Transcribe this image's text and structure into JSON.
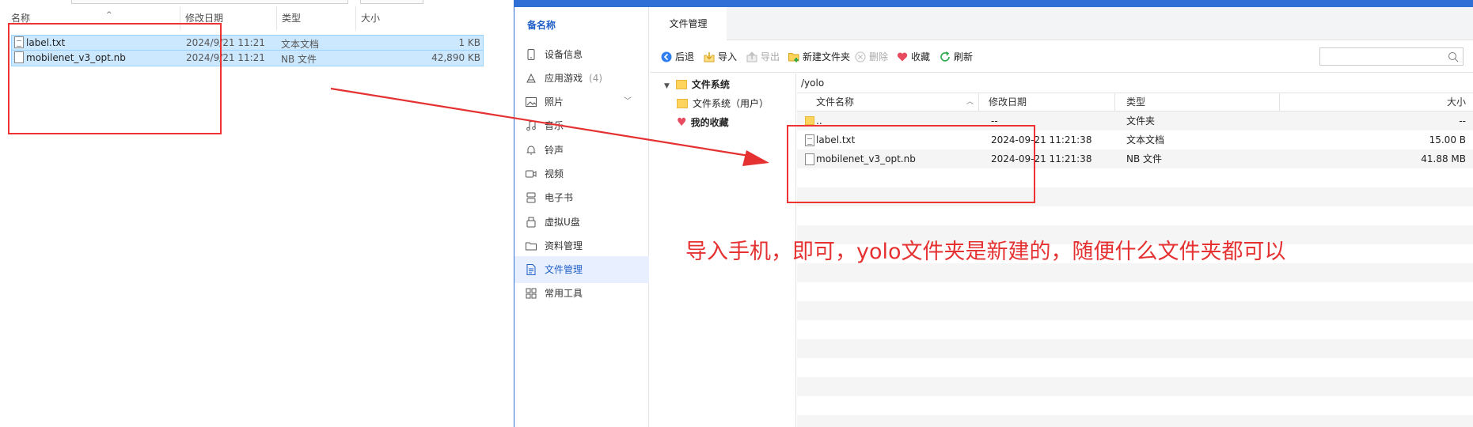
{
  "explorer": {
    "columns": {
      "name": "名称",
      "modified": "修改日期",
      "type": "类型",
      "size": "大小"
    },
    "files": [
      {
        "name": "label.txt",
        "modified": "2024/9/21 11:21",
        "type": "文本文档",
        "size": "1 KB",
        "icon": "text-file-icon"
      },
      {
        "name": "mobilenet_v3_opt.nb",
        "modified": "2024/9/21 11:21",
        "type": "NB 文件",
        "size": "42,890 KB",
        "icon": "file-icon"
      }
    ]
  },
  "sidebar": {
    "brand": "备名称",
    "items": [
      {
        "label": "设备信息",
        "icon": "phone-icon"
      },
      {
        "label": "应用游戏",
        "count": "(4)",
        "icon": "app-icon"
      },
      {
        "label": "照片",
        "icon": "image-icon"
      },
      {
        "label": "音乐",
        "icon": "music-icon"
      },
      {
        "label": "铃声",
        "icon": "bell-icon"
      },
      {
        "label": "视频",
        "icon": "video-icon"
      },
      {
        "label": "电子书",
        "icon": "book-icon"
      },
      {
        "label": "虚拟U盘",
        "icon": "usb-icon"
      },
      {
        "label": "资料管理",
        "icon": "folder-icon"
      },
      {
        "label": "文件管理",
        "icon": "document-icon",
        "active": true
      },
      {
        "label": "常用工具",
        "icon": "grid-icon"
      }
    ]
  },
  "tabs": [
    {
      "label": "文件管理"
    }
  ],
  "toolbar": {
    "back": "后退",
    "import": "导入",
    "export": "导出",
    "new_folder": "新建文件夹",
    "delete": "删除",
    "favorite": "收藏",
    "refresh": "刷新",
    "search_placeholder": ""
  },
  "tree": {
    "filesystem": "文件系统",
    "filesystem_user": "文件系统（用户）",
    "favorites": "我的收藏"
  },
  "file_list": {
    "path": "/yolo",
    "columns": {
      "name": "文件名称",
      "modified": "修改日期",
      "type": "类型",
      "size": "大小"
    },
    "rows": [
      {
        "name": "..",
        "modified": "--",
        "type": "文件夹",
        "size": "--",
        "icon": "folder-icon"
      },
      {
        "name": "label.txt",
        "modified": "2024-09-21 11:21:38",
        "type": "文本文档",
        "size": "15.00 B",
        "icon": "text-file-icon"
      },
      {
        "name": "mobilenet_v3_opt.nb",
        "modified": "2024-09-21 11:21:38",
        "type": "NB 文件",
        "size": "41.88 MB",
        "icon": "file-icon"
      }
    ]
  },
  "annotation": {
    "text": "导入手机，即可，yolo文件夹是新建的，随便什么文件夹都可以",
    "color": "#e53131"
  },
  "colors": {
    "accent": "#2f6fd6",
    "selection": "#cce8ff",
    "active_nav": "#e8efff"
  }
}
